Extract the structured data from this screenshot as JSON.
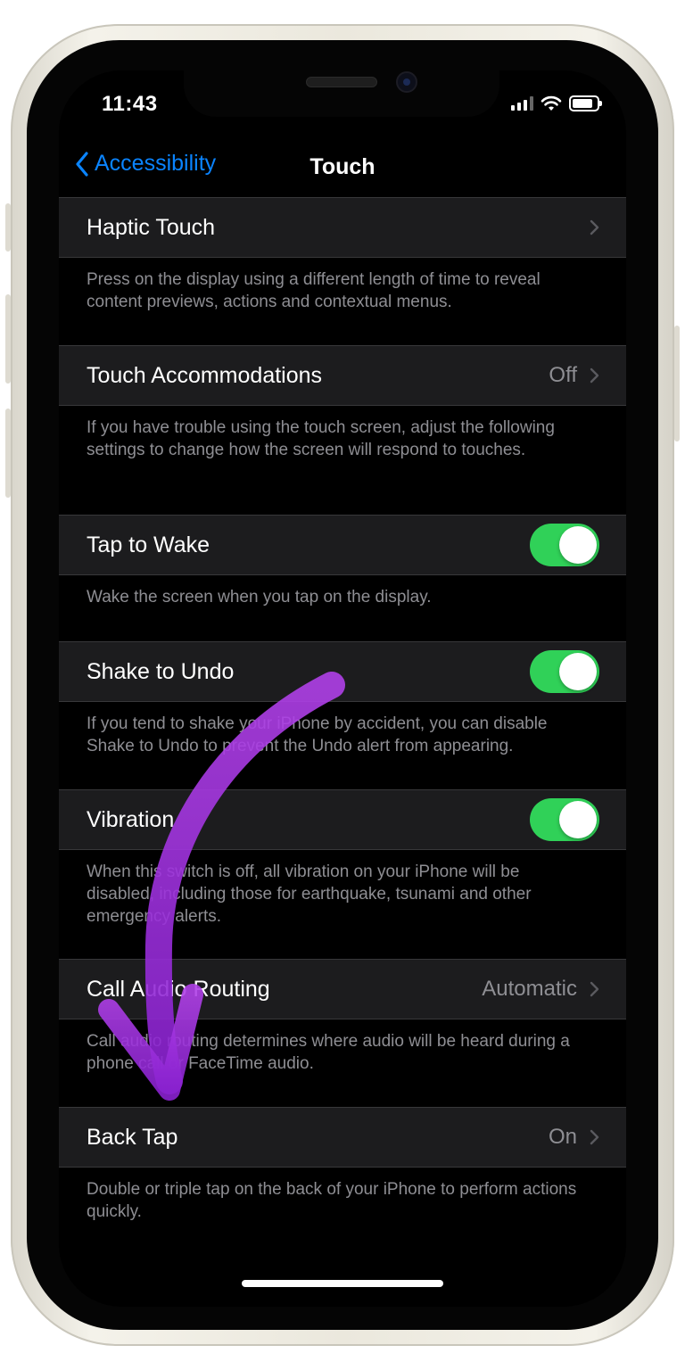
{
  "status_bar": {
    "time": "11:43"
  },
  "nav": {
    "back_label": "Accessibility",
    "title": "Touch"
  },
  "accent_color": "#0a84ff",
  "toggle_on_color": "#30d158",
  "annotation_color": "#9b30d9",
  "rows": [
    {
      "label": "Haptic Touch",
      "value": "",
      "control": "chevron",
      "footer": "Press on the display using a different length of time to reveal content previews, actions and contextual menus."
    },
    {
      "label": "Touch Accommodations",
      "value": "Off",
      "control": "chevron",
      "footer": "If you have trouble using the touch screen, adjust the following settings to change how the screen will respond to touches."
    },
    {
      "label": "Tap to Wake",
      "value": "",
      "control": "toggle",
      "on": true,
      "footer": "Wake the screen when you tap on the display."
    },
    {
      "label": "Shake to Undo",
      "value": "",
      "control": "toggle",
      "on": true,
      "footer": "If you tend to shake your iPhone by accident, you can disable Shake to Undo to prevent the Undo alert from appearing."
    },
    {
      "label": "Vibration",
      "value": "",
      "control": "toggle",
      "on": true,
      "footer": "When this switch is off, all vibration on your iPhone will be disabled, including those for earthquake, tsunami and other emergency alerts."
    },
    {
      "label": "Call Audio Routing",
      "value": "Automatic",
      "control": "chevron",
      "footer": "Call audio routing determines where audio will be heard during a phone call or FaceTime audio."
    },
    {
      "label": "Back Tap",
      "value": "On",
      "control": "chevron",
      "footer": "Double or triple tap on the back of your iPhone to perform actions quickly."
    }
  ]
}
